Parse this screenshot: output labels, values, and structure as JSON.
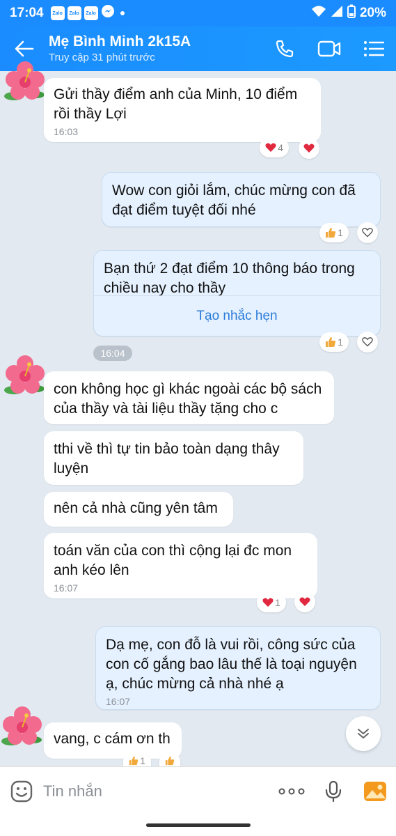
{
  "status_bar": {
    "time": "17:04",
    "app_icons": [
      "Zalo",
      "Zalo",
      "Zalo"
    ],
    "battery": "20%"
  },
  "header": {
    "contact_name": "Mẹ Bình Minh 2k15A",
    "last_seen": "Truy cập 31 phút trước"
  },
  "messages": [
    {
      "text": "Gửi thầy điểm anh của Minh, 10 điểm rồi thầy Lợi",
      "time": "16:03",
      "reaction_count": "4"
    },
    {
      "text": "Wow con giỏi lắm, chúc mừng con đã đạt điểm tuyệt đối nhé",
      "reaction_count": "1"
    },
    {
      "text": "Bạn thứ 2 đạt điểm 10 thông báo trong chiều nay cho thầy",
      "link_label": "Tạo nhắc hẹn",
      "reaction_count": "1"
    },
    {
      "text": "con không học gì khác ngoài các bộ sách của thầy và tài liệu thầy tặng cho c"
    },
    {
      "text": "tthi về thì tự tin bảo toàn dạng thây luyện"
    },
    {
      "text": "nên cả nhà cũng yên tâm"
    },
    {
      "text": "toán văn của con thì cộng lại đc mon anh kéo lên",
      "time": "16:07",
      "reaction_count": "1"
    },
    {
      "text": "Dạ mẹ, con đỗ là vui rồi, công sức của con cố gắng bao lâu thế là toại nguyện ạ, chúc mừng cả nhà nhé ạ",
      "time": "16:07"
    },
    {
      "text": "vang, c cám ơn th",
      "reaction_count": "1"
    }
  ],
  "time_separator": "16:04",
  "input": {
    "placeholder": "Tin nhắn"
  },
  "colors": {
    "brand": "#1A8CFF",
    "chat_background": "#E2E9F1",
    "outgoing_bubble": "#E5F1FF",
    "heart": "#E0283F",
    "like": "#F2A93B"
  },
  "icons": [
    "back-arrow-icon",
    "phone-icon",
    "video-call-icon",
    "menu-icon",
    "heart-icon",
    "thumbs-up-icon",
    "outline-heart-icon",
    "chevron-down-icon",
    "emoji-icon",
    "more-icon",
    "microphone-icon",
    "image-icon",
    "wifi-icon",
    "signal-icon",
    "battery-icon",
    "messenger-icon"
  ]
}
